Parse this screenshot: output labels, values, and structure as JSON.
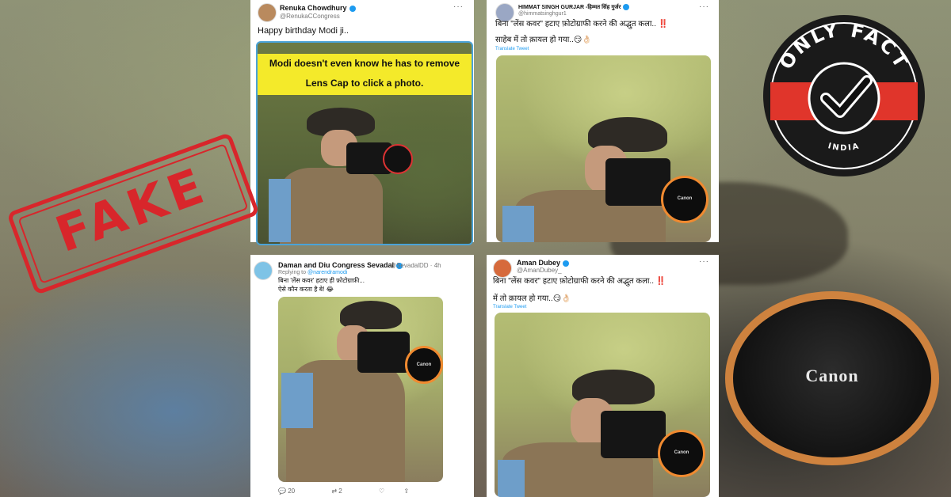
{
  "logo": {
    "top_text": "ONLY FACT",
    "bottom_text": "INDIA"
  },
  "stamp": {
    "text": "FAKE"
  },
  "background": {
    "cap_text": "Canon"
  },
  "tweets": [
    {
      "name": "Renuka Chowdhury",
      "handle": "@RenukaCCongress",
      "text": "Happy birthday Modi ji..",
      "banner_line1": "Modi doesn't even know he has to remove",
      "banner_line2": "Lens Cap to click a photo."
    },
    {
      "name": "HIMMAT SINGH GURJAR -हिम्मत सिंह गुर्जर",
      "handle": "@himmatsinghgur1",
      "text_line1": "बिना \"लेंस कवर\" हटाए फ़ोटोग्राफी करने की अद्भुत कला.. ‼️",
      "text_line2": "साहेब में तो क़ायल हो गया..😏👌🏻",
      "translate": "Translate Tweet",
      "lens_text": "Canon"
    },
    {
      "name": "Daman and Diu Congress Sevadal",
      "handle": "@SevadalDD · 4h",
      "replying_prefix": "Replying to",
      "replying_handle": "@narendramodi",
      "text_line1": "बिना 'लेंस कवर' हटाए ही फ़ोटोग्राफ़ी...",
      "text_line2": "ऐसे कौन करता है बे! 😂",
      "lens_text": "Canon",
      "replies": "20",
      "retweets": "2"
    },
    {
      "name": "Aman Dubey",
      "handle": "@AmanDubey_",
      "text_line1": "बिना \"लेंस कवर\" हटाए फ़ोटोग्राफी करने की अद्भुत कला.. ‼️",
      "text_line2": "में तो क़ायल हो गया..😏👌🏻",
      "translate": "Translate Tweet",
      "lens_text": "Canon"
    }
  ]
}
